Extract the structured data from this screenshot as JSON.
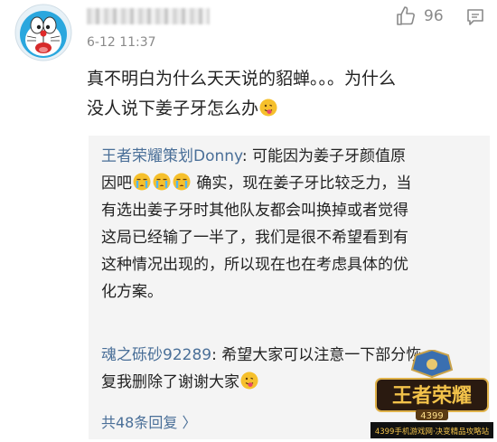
{
  "comment": {
    "timestamp": "6-12 11:37",
    "like_count": "96",
    "text_line1": "真不明白为什么天天说的貂蝉。。。为什么",
    "text_line2": "没人说下姜子牙怎么办"
  },
  "replies": [
    {
      "user": "王者荣耀策划Donny",
      "sep": ": ",
      "line1": "可能因为姜子牙颜值原",
      "line2a": "因吧",
      "line2b": "确实，现在姜子牙比较乏力，当",
      "line3": "有选出姜子牙时其他队友都会叫换掉或者觉得",
      "line4": "这局已经输了一半了，我们是很不希望看到有",
      "line5": "这种情况出现的，所以现在也在考虑具体的优",
      "line6": "化方案。"
    },
    {
      "user": "魂之砾砂92289",
      "sep": ": ",
      "line1": "希望大家可以注意一下部分恢",
      "line2": "复我删除了谢谢大家"
    }
  ],
  "more_replies": "共48条回复",
  "more_chevron": "〉",
  "watermark": {
    "logo_text": "王者荣耀",
    "logo_sub": "4399",
    "banner": "4399手机游戏网·决变精品攻略站"
  },
  "icons": [
    "avatar-doraemon",
    "thumbs-up-icon",
    "reply-icon",
    "tongue-emoji",
    "crying-emoji",
    "game-logo"
  ],
  "colors": {
    "link": "#4a6f98",
    "muted": "#8a8a8a",
    "reply_bg": "#f4f4f4"
  }
}
